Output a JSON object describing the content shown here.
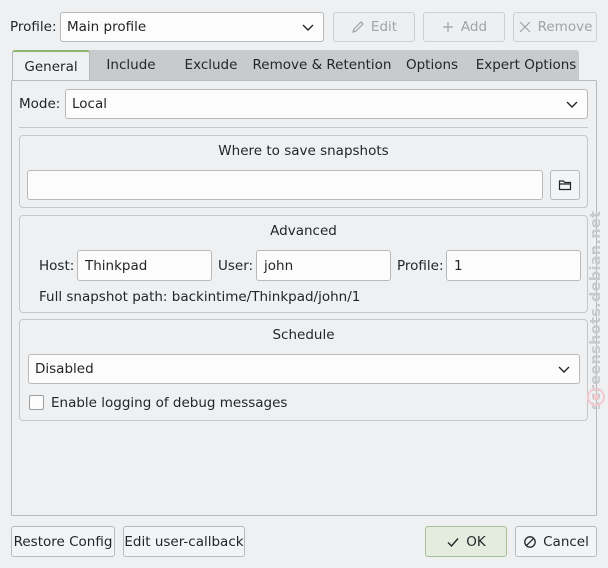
{
  "profile": {
    "label": "Profile:",
    "selected": "Main profile",
    "edit_label": "Edit",
    "add_label": "Add",
    "remove_label": "Remove"
  },
  "tabs": [
    {
      "label": "General",
      "active": true
    },
    {
      "label": "Include"
    },
    {
      "label": "Exclude"
    },
    {
      "label": "Remove & Retention"
    },
    {
      "label": "Options"
    },
    {
      "label": "Expert Options"
    }
  ],
  "mode": {
    "label": "Mode:",
    "selected": "Local"
  },
  "save_group": {
    "title": "Where to save snapshots",
    "path_value": ""
  },
  "advanced": {
    "title": "Advanced",
    "host_label": "Host:",
    "host_value": "Thinkpad",
    "user_label": "User:",
    "user_value": "john",
    "profile_label": "Profile:",
    "profile_value": "1",
    "full_path": "Full snapshot path: backintime/Thinkpad/john/1"
  },
  "schedule": {
    "title": "Schedule",
    "selected": "Disabled",
    "debug_label": "Enable logging of debug messages",
    "debug_checked": false
  },
  "footer": {
    "restore_label": "Restore Config",
    "callback_label": "Edit user-callback",
    "ok_label": "OK",
    "cancel_label": "Cancel"
  },
  "watermark": "screenshots.debian.net",
  "colors": {
    "accent": "#8db56d",
    "ok_bg": "#e4ecdf",
    "window_bg": "#eff0f1"
  }
}
